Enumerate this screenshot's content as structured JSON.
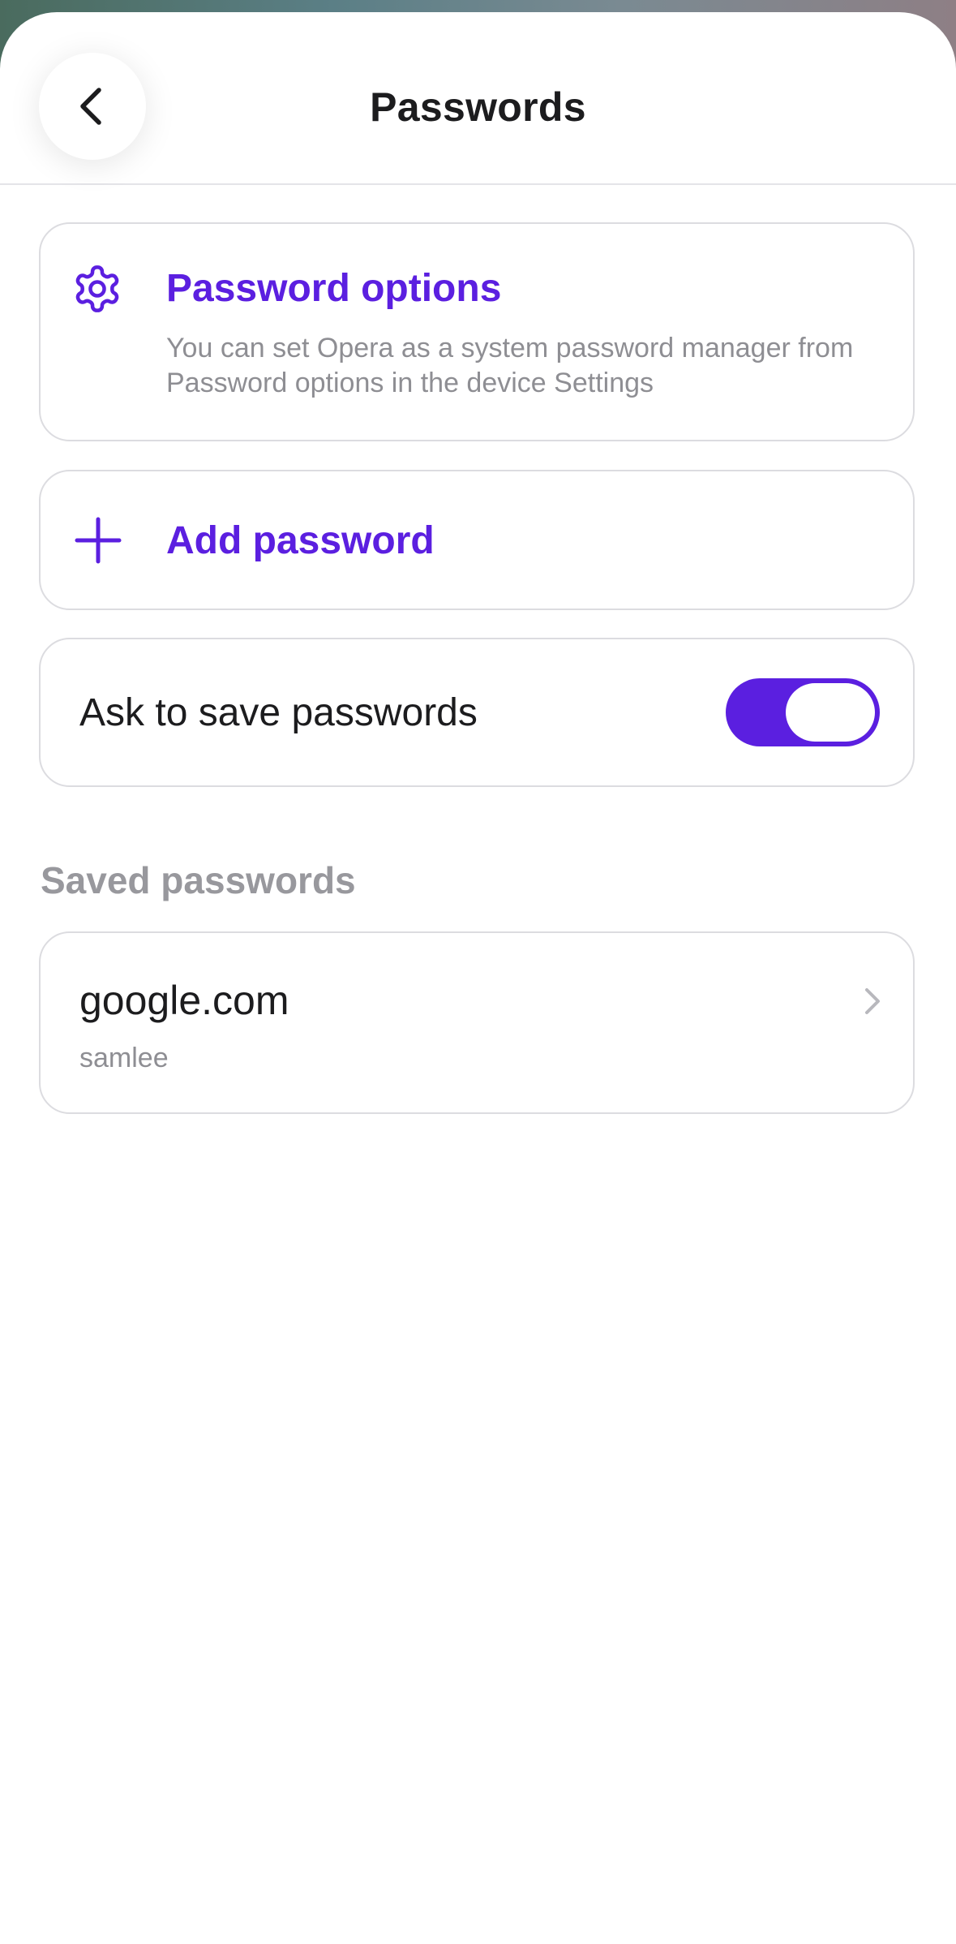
{
  "header": {
    "title": "Passwords",
    "back_icon": "chevron-left-icon"
  },
  "password_options": {
    "icon": "gear-icon",
    "title": "Password options",
    "description": "You can set Opera as a system password manager from Password options in the device Settings"
  },
  "add_password": {
    "icon": "plus-icon",
    "label": "Add password"
  },
  "ask_to_save": {
    "label": "Ask to save passwords",
    "enabled": true
  },
  "saved_passwords": {
    "section_title": "Saved passwords",
    "items": [
      {
        "domain": "google.com",
        "username": "samlee",
        "icon": "chevron-right-icon"
      }
    ]
  },
  "colors": {
    "accent": "#5b1fe0",
    "text_primary": "#1c1c1e",
    "text_secondary": "#8e8e93",
    "border": "#dcdce0"
  }
}
